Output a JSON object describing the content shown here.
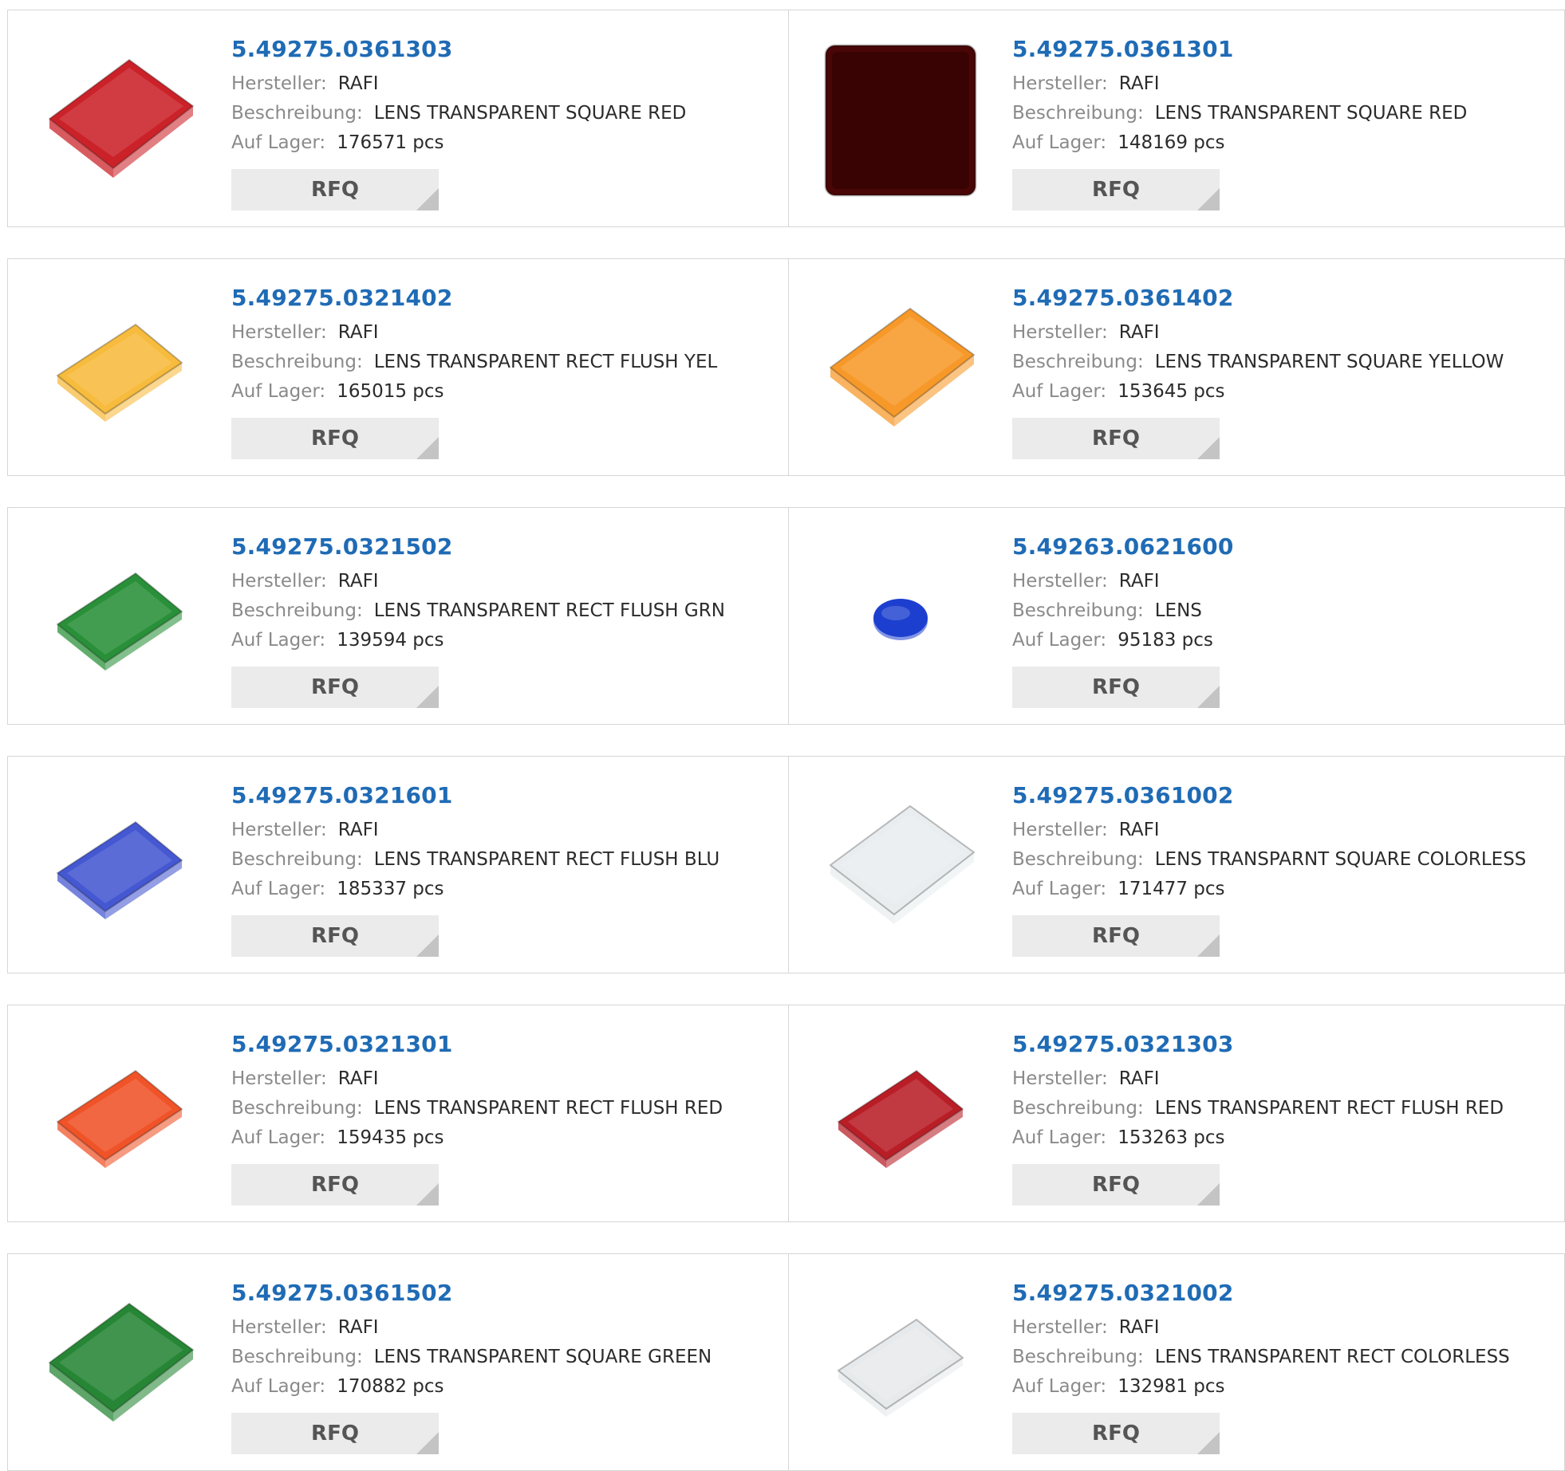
{
  "labels": {
    "manufacturer": "Hersteller:",
    "description": "Beschreibung:",
    "stock": "Auf Lager:",
    "rfq": "RFQ"
  },
  "products": [
    {
      "part": "5.49275.0361303",
      "manufacturer": "RAFI",
      "description": "LENS TRANSPARENT SQUARE RED",
      "stock": "176571 pcs",
      "icon": "red-square-lens-icon",
      "color": "#c8161d",
      "shape": "square"
    },
    {
      "part": "5.49275.0361301",
      "manufacturer": "RAFI",
      "description": "LENS TRANSPARENT SQUARE RED",
      "stock": "148169 pcs",
      "icon": "dark-red-square-lens-icon",
      "color": "#4a0606",
      "shape": "flat-square"
    },
    {
      "part": "5.49275.0321402",
      "manufacturer": "RAFI",
      "description": "LENS TRANSPARENT RECT FLUSH YEL",
      "stock": "165015 pcs",
      "icon": "yellow-rect-lens-icon",
      "color": "#f7b733",
      "shape": "rect"
    },
    {
      "part": "5.49275.0361402",
      "manufacturer": "RAFI",
      "description": "LENS TRANSPARENT SQUARE YELLOW",
      "stock": "153645 pcs",
      "icon": "orange-square-lens-icon",
      "color": "#f7931e",
      "shape": "square"
    },
    {
      "part": "5.49275.0321502",
      "manufacturer": "RAFI",
      "description": "LENS TRANSPARENT RECT FLUSH GRN",
      "stock": "139594 pcs",
      "icon": "green-rect-lens-icon",
      "color": "#1e8a2e",
      "shape": "rect"
    },
    {
      "part": "5.49263.0621600",
      "manufacturer": "RAFI",
      "description": "LENS",
      "stock": "95183 pcs",
      "icon": "blue-round-lens-icon",
      "color": "#1d3fcf",
      "shape": "round"
    },
    {
      "part": "5.49275.0321601",
      "manufacturer": "RAFI",
      "description": "LENS TRANSPARENT RECT FLUSH BLU",
      "stock": "185337 pcs",
      "icon": "blue-rect-lens-icon",
      "color": "#3b4fd0",
      "shape": "rect"
    },
    {
      "part": "5.49275.0361002",
      "manufacturer": "RAFI",
      "description": "LENS TRANSPARNT SQUARE COLORLESS",
      "stock": "171477 pcs",
      "icon": "clear-square-lens-icon",
      "color": "#e8ecee",
      "shape": "square"
    },
    {
      "part": "5.49275.0321301",
      "manufacturer": "RAFI",
      "description": "LENS TRANSPARENT RECT FLUSH RED",
      "stock": "159435 pcs",
      "icon": "orange-red-rect-lens-icon",
      "color": "#ef4a1c",
      "shape": "rect"
    },
    {
      "part": "5.49275.0321303",
      "manufacturer": "RAFI",
      "description": "LENS TRANSPARENT RECT FLUSH RED",
      "stock": "153263 pcs",
      "icon": "red-rect-lens-icon",
      "color": "#b5121b",
      "shape": "rect"
    },
    {
      "part": "5.49275.0361502",
      "manufacturer": "RAFI",
      "description": "LENS TRANSPARENT SQUARE GREEN",
      "stock": "170882 pcs",
      "icon": "green-square-lens-icon",
      "color": "#1a7f2a",
      "shape": "square"
    },
    {
      "part": "5.49275.0321002",
      "manufacturer": "RAFI",
      "description": "LENS TRANSPARENT RECT COLORLESS",
      "stock": "132981 pcs",
      "icon": "clear-rect-lens-icon",
      "color": "#e6e9eb",
      "shape": "rect"
    }
  ]
}
